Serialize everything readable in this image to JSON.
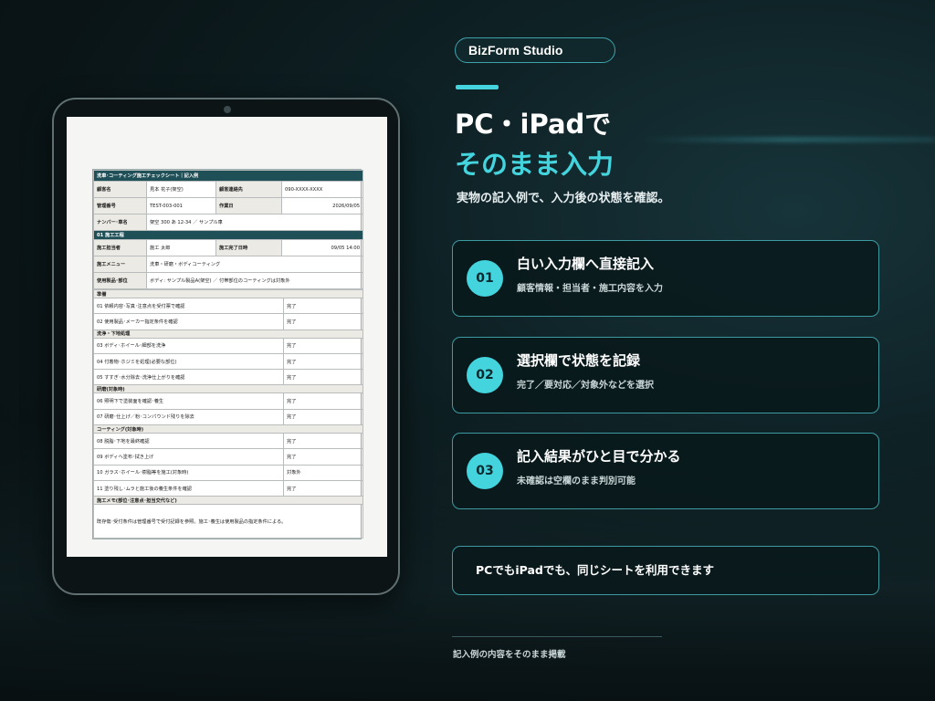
{
  "brand": {
    "badge_label": "BizForm Studio"
  },
  "hero": {
    "title_line1": "PC・iPadで",
    "title_line2": "そのまま入力",
    "lead": "実物の記入例で、入力後の状態を確認。",
    "accent_color": "#44d4de"
  },
  "features": [
    {
      "number": "01",
      "title": "白い入力欄へ直接記入",
      "description": "顧客情報・担当者・施工内容を入力"
    },
    {
      "number": "02",
      "title": "選択欄で状態を記録",
      "description": "完了／要対応／対象外などを選択"
    },
    {
      "number": "03",
      "title": "記入結果がひと目で分かる",
      "description": "未確認は空欄のまま判別可能"
    }
  ],
  "banner": {
    "text": "PCでもiPadでも、同じシートを利用できます"
  },
  "footer": {
    "note": "記入例の内容をそのまま掲載"
  },
  "sheet": {
    "title": "洗車･コーティング施工チェックシート｜記入例",
    "customer_label": "顧客名",
    "customer_value": "見本 花子(架空)",
    "contact_label": "顧客連絡先",
    "contact_value": "090-XXXX-XXXX",
    "mgmt_label": "管理番号",
    "mgmt_value": "TEST-003-001",
    "date_label": "作業日",
    "date_value": "2026/09/05",
    "plate_label": "ナンバー･車名",
    "plate_value": "架空 300 あ 12-34 ／ サンプル車",
    "section_label": "01  施工工程",
    "staff_label": "施工担当者",
    "staff_value": "施工 太郎",
    "done_label": "施工完了日時",
    "done_value": "09/05 14:00",
    "menu_label": "施工メニュー",
    "menu_value": "洗車・研磨・ボディコーティング",
    "product_label": "使用製品･部位",
    "product_value": "ボディ: サンプル製品A(架空) ／ 付帯部位のコーティングは対象外",
    "groups": {
      "prep": "準備",
      "wash": "洗浄・下地処理",
      "polish": "研磨(対象時)",
      "coat": "コーティング(対象時)"
    },
    "items": [
      {
        "label": "01  依頼内容･写真･注意点を受付票で確認",
        "status": "完了"
      },
      {
        "label": "02  使用製品･メーカー指定条件を確認",
        "status": "完了"
      },
      {
        "label": "03  ボディ･ホイール･細部を洗浄",
        "status": "完了"
      },
      {
        "label": "04  付着物･ホジミを処理(必要な部位)",
        "status": "完了"
      },
      {
        "label": "05  すすぎ･水分除去･洗浄仕上がりを確認",
        "status": "完了"
      },
      {
        "label": "06  照明下で塗装面を確認･養生",
        "status": "完了"
      },
      {
        "label": "07  研磨･仕上げ／粉･コンパウンド残りを除去",
        "status": "完了"
      },
      {
        "label": "08  脱脂･下地を最終確認",
        "status": "完了"
      },
      {
        "label": "09  ボディへ塗布･拭き上げ",
        "status": "完了"
      },
      {
        "label": "10  ガラス･ホイール･樹脂等を施工(対象時)",
        "status": "対象外"
      },
      {
        "label": "11  塗り残し･ムラと施工後の養生条件を確認",
        "status": "完了"
      }
    ],
    "memo_label": "施工メモ(部位･注意点･担当交代など)",
    "memo_value": "既存傷･受付条件は管理番号で受付記録を参照。施工･養生は使用製品の指定条件による。"
  }
}
